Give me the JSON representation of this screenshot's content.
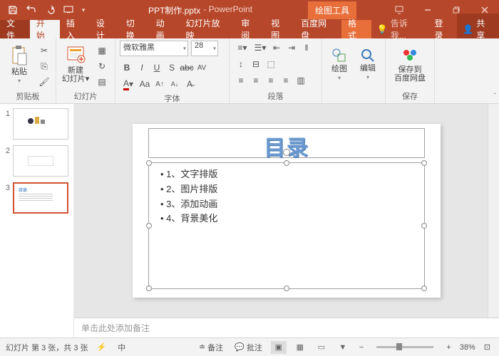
{
  "title": {
    "doc": "PPT制作.pptx",
    "app": "PowerPoint",
    "context_tool": "绘图工具"
  },
  "qat": {
    "save": "保存",
    "undo": "撤消",
    "redo": "恢复",
    "start": "从头开始"
  },
  "window": {
    "min": "最小化",
    "restore": "向下还原",
    "close": "关闭"
  },
  "tabs": {
    "file": "文件",
    "home": "开始",
    "insert": "插入",
    "design": "设计",
    "transitions": "切换",
    "animations": "动画",
    "slideshow": "幻灯片放映",
    "review": "审阅",
    "view": "视图",
    "baidu": "百度网盘",
    "format": "格式",
    "tellme": "告诉我...",
    "login": "登录",
    "share": "共享"
  },
  "ribbon": {
    "clipboard": {
      "paste": "粘贴",
      "label": "剪贴板"
    },
    "slides": {
      "new": "新建",
      "new2": "幻灯片",
      "label": "幻灯片"
    },
    "font": {
      "name": "微软雅黑",
      "size": "28",
      "label": "字体"
    },
    "paragraph": {
      "label": "段落"
    },
    "drawing": {
      "draw": "绘图",
      "edit": "编辑"
    },
    "save": {
      "btn1": "保存到",
      "btn2": "百度网盘",
      "label": "保存"
    }
  },
  "thumbs": [
    {
      "num": "1"
    },
    {
      "num": "2"
    },
    {
      "num": "3"
    }
  ],
  "slide": {
    "title_text": "目录",
    "bullets": [
      "1、文字排版",
      "2、图片排版",
      "3、添加动画",
      "4、背景美化"
    ]
  },
  "notes_placeholder": "单击此处添加备注",
  "status": {
    "slide_info": "幻灯片 第 3 张，共 3 张",
    "lang": "中",
    "notes": "备注",
    "comments": "批注",
    "zoom_out": "−",
    "zoom_in": "+",
    "zoom_pct": "38%",
    "fit": "⊡"
  }
}
